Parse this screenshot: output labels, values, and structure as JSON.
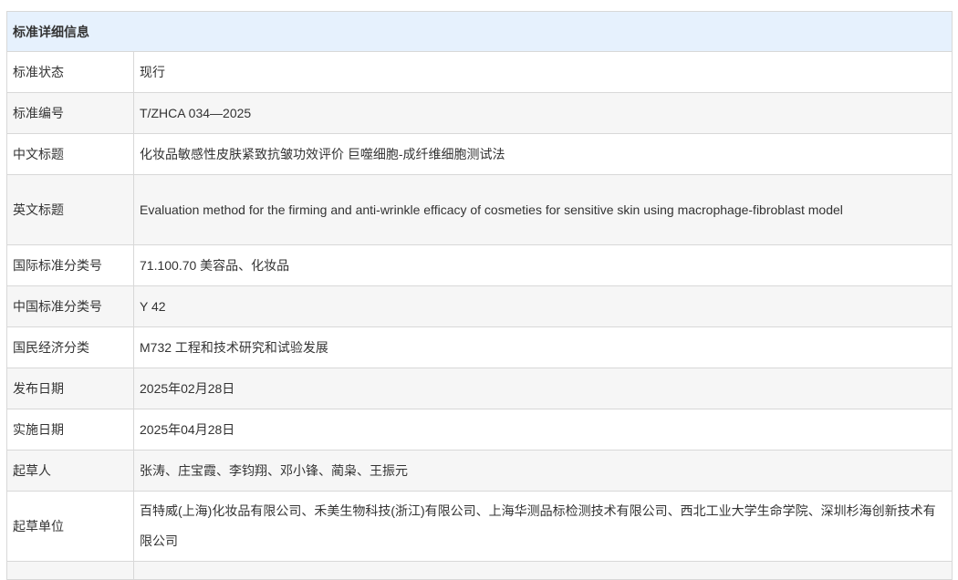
{
  "table": {
    "header": "标准详细信息",
    "rows": [
      {
        "label": "标准状态",
        "value": "现行"
      },
      {
        "label": "标准编号",
        "value": "T/ZHCA 034—2025"
      },
      {
        "label": "中文标题",
        "value": "化妆品敏感性皮肤紧致抗皱功效评价 巨噬细胞-成纤维细胞测试法"
      },
      {
        "label": "英文标题",
        "value": "Evaluation method for the firming and anti-wrinkle efficacy of cosmeties for sensitive skin using macrophage-fibroblast model"
      },
      {
        "label": "国际标准分类号",
        "value": "71.100.70 美容品、化妆品"
      },
      {
        "label": "中国标准分类号",
        "value": "Y 42"
      },
      {
        "label": "国民经济分类",
        "value": "M732 工程和技术研究和试验发展"
      },
      {
        "label": "发布日期",
        "value": "2025年02月28日"
      },
      {
        "label": "实施日期",
        "value": "2025年04月28日"
      },
      {
        "label": "起草人",
        "value": "张涛、庄宝霞、李钧翔、邓小锋、蔺枭、王振元"
      },
      {
        "label": "起草单位",
        "value": "百特威(上海)化妆品有限公司、禾美生物科技(浙江)有限公司、上海华测品标检测技术有限公司、西北工业大学生命学院、深圳杉海创新技术有限公司"
      }
    ]
  }
}
